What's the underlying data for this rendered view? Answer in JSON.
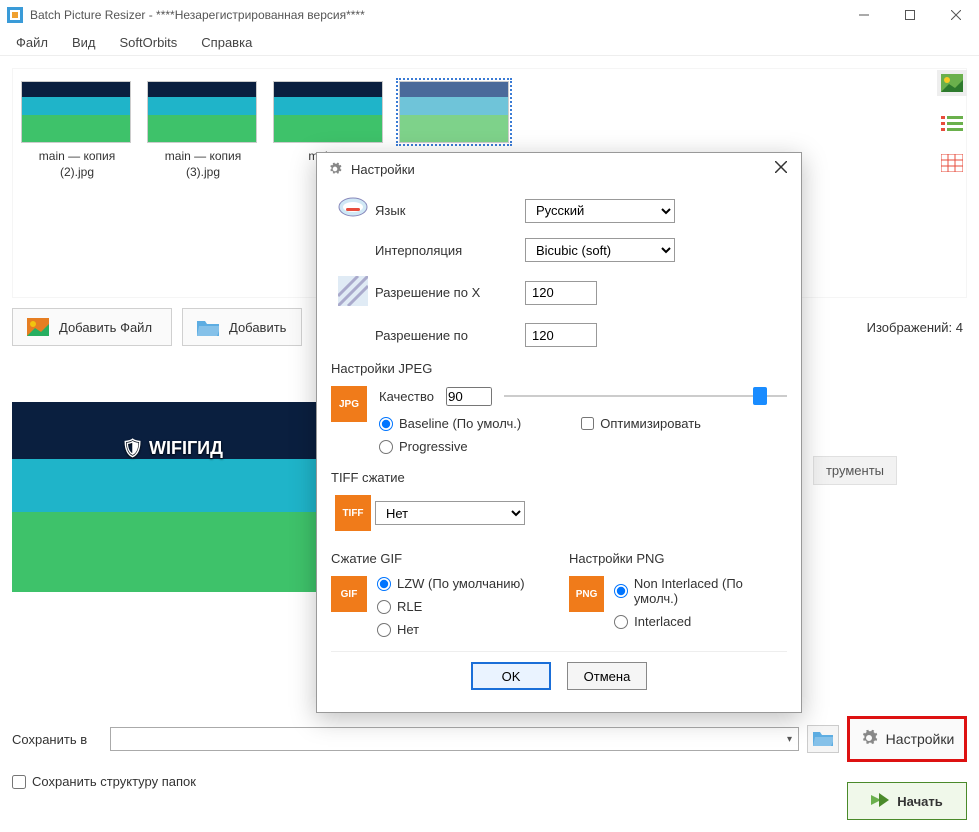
{
  "window": {
    "title": "Batch Picture Resizer - ****Незарегистрированная версия****"
  },
  "menu": {
    "file": "Файл",
    "view": "Вид",
    "softorbits": "SoftOrbits",
    "help": "Справка"
  },
  "thumbs": {
    "items": [
      {
        "caption": "main — копия (2).jpg"
      },
      {
        "caption": "main — копия (3).jpg"
      },
      {
        "caption": "main —"
      },
      {
        "caption": ""
      }
    ]
  },
  "actions": {
    "add_file": "Добавить Файл",
    "add_folder": "Добавить",
    "count_label": "Изображений: 4"
  },
  "tab_stub": "трументы",
  "preview_logo": "WIFIГИД",
  "bottom": {
    "save_in": "Сохранить в",
    "settings": "Настройки",
    "start": "Начать",
    "keep_structure": "Сохранить структуру папок"
  },
  "dialog": {
    "title": "Настройки",
    "lang_label": "Язык",
    "lang_value": "Русский",
    "interp_label": "Интерполяция",
    "interp_value": "Bicubic (soft)",
    "res_x_label": "Разрешение по X",
    "res_x_value": "120",
    "res_y_label": "Разрешение по",
    "res_y_value": "120",
    "jpeg_section": "Настройки JPEG",
    "quality_label": "Качество",
    "quality_value": "90",
    "baseline": "Baseline (По умолч.)",
    "progressive": "Progressive",
    "optimize": "Оптимизировать",
    "tiff_section": "TIFF сжатие",
    "tiff_value": "Нет",
    "gif_section": "Сжатие GIF",
    "gif_lzw": "LZW (По умолчанию)",
    "gif_rle": "RLE",
    "gif_none": "Нет",
    "png_section": "Настройки PNG",
    "png_noninterlaced": "Non Interlaced (По умолч.)",
    "png_interlaced": "Interlaced",
    "ok": "OK",
    "cancel": "Отмена",
    "jpg_badge": "JPG",
    "tiff_badge": "TIFF",
    "gif_badge": "GIF",
    "png_badge": "PNG"
  }
}
